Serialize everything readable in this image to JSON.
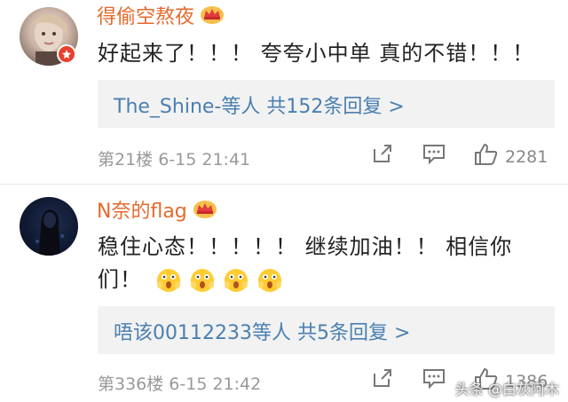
{
  "comments": [
    {
      "username": "得偷空熬夜",
      "text": "好起来了！！！ 夸夸小中单 真的不错！！！",
      "reply_summary": "The_Shine-等人  共152条回复 >",
      "floor": "第21楼 6-15 21:41",
      "likes": "2281"
    },
    {
      "username": "N奈的flag",
      "text_line1": "稳住心态！！！！！ 继续加油！！ 相信你",
      "text_line2": "们！",
      "emoji_count": 4,
      "reply_summary": "唔该00112233等人  共5条回复 >",
      "floor": "第336楼 6-15 21:42",
      "likes": "1386"
    }
  ],
  "watermark": "头条 @白灰阿木",
  "icons": {
    "share": "share-icon",
    "comment": "comment-icon",
    "like": "thumbs-up-icon",
    "crown": "crown-icon",
    "verified": "verified-badge-icon"
  },
  "colors": {
    "username": "#e56a2c",
    "link": "#4a7fb0",
    "meta": "#999999",
    "reply_bg": "#f2f2f2"
  }
}
